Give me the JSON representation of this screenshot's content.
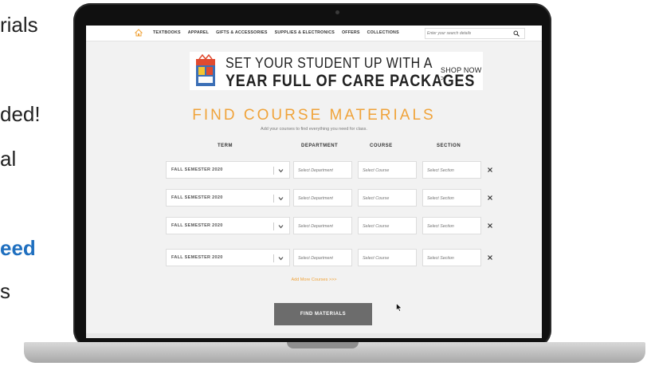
{
  "slide_text": [
    "rials",
    "ded!",
    "al",
    "eed",
    "s"
  ],
  "nav": {
    "items": [
      "TEXTBOOKS",
      "APPAREL",
      "GIFTS & ACCESSORIES",
      "SUPPLIES & ELECTRONICS",
      "OFFERS",
      "COLLECTIONS"
    ],
    "search_placeholder": "Enter your search details"
  },
  "banner": {
    "line1": "SET YOUR STUDENT UP WITH A",
    "line2": "YEAR FULL OF CARE PACKAGES",
    "cta": "SHOP NOW >"
  },
  "page": {
    "title": "FIND COURSE MATERIALS",
    "subtitle": "Add your courses to find everything you need for class."
  },
  "columns": [
    "TERM",
    "DEPARTMENT",
    "COURSE",
    "SECTION"
  ],
  "rows": [
    {
      "term": "FALL SEMESTER 2020",
      "department_placeholder": "Select Department",
      "course_placeholder": "Select Course",
      "section_placeholder": "Select Section"
    },
    {
      "term": "FALL SEMESTER 2020",
      "department_placeholder": "Select Department",
      "course_placeholder": "Select Course",
      "section_placeholder": "Select Section"
    },
    {
      "term": "FALL SEMESTER 2020",
      "department_placeholder": "Select Department",
      "course_placeholder": "Select Course",
      "section_placeholder": "Select Section"
    },
    {
      "term": "FALL SEMESTER 2020",
      "department_placeholder": "Select Department",
      "course_placeholder": "Select Course",
      "section_placeholder": "Select Section"
    }
  ],
  "add_more": "Add More Courses >>>",
  "find_button": "FIND MATERIALS",
  "colors": {
    "accent": "#f0a33a",
    "button": "#6c6c6c",
    "slide_highlight": "#1f6fbf"
  },
  "icons": {
    "home": "home-icon",
    "search": "search-icon",
    "chevron": "chevron-down-icon",
    "remove": "close-icon",
    "cursor": "mouse-pointer-icon"
  }
}
